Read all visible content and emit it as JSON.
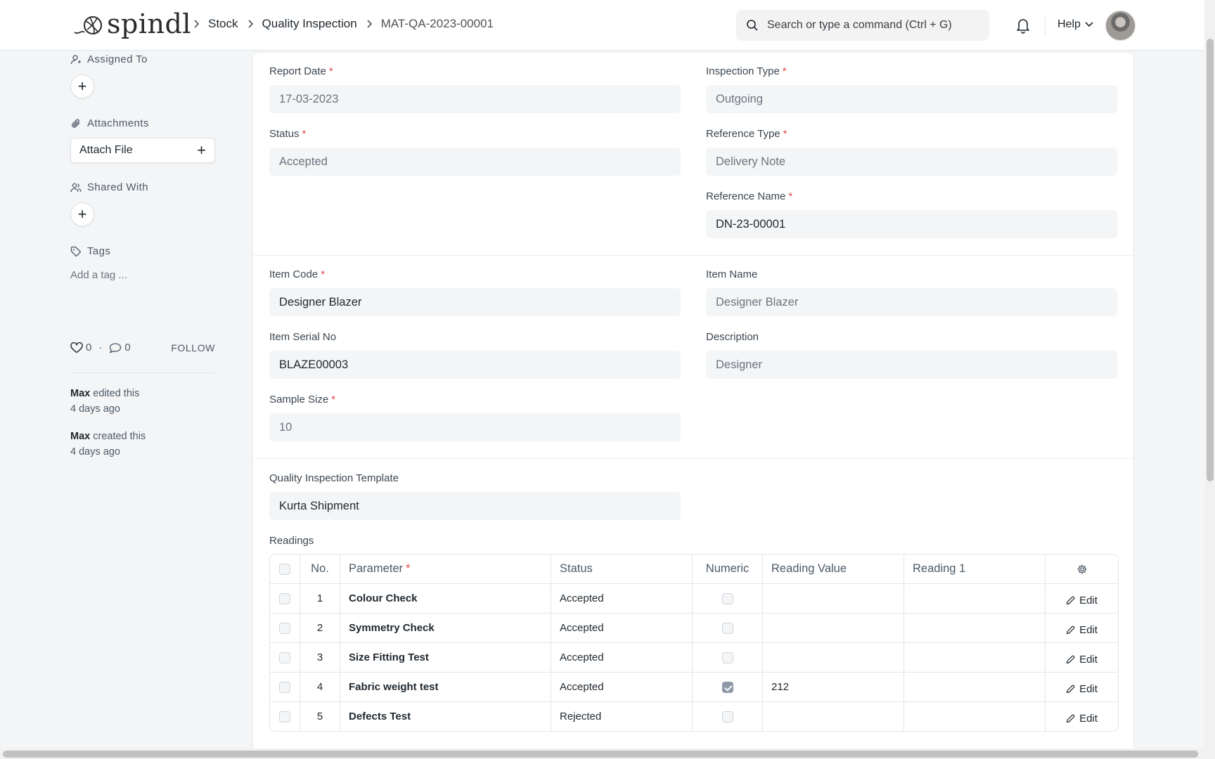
{
  "brand": {
    "name": "spindl"
  },
  "breadcrumb": [
    "Stock",
    "Quality Inspection",
    "MAT-QA-2023-00001"
  ],
  "search": {
    "placeholder": "Search or type a command (Ctrl + G)"
  },
  "nav": {
    "help_label": "Help"
  },
  "sidebar": {
    "assigned_to": "Assigned To",
    "attachments": "Attachments",
    "attach_file": "Attach File",
    "shared_with": "Shared With",
    "tags": "Tags",
    "add_tag": "Add a tag ...",
    "likes": "0",
    "dot": "·",
    "comments": "0",
    "follow": "FOLLOW",
    "activity": [
      {
        "user": "Max",
        "action": "edited this",
        "time": "4 days ago"
      },
      {
        "user": "Max",
        "action": "created this",
        "time": "4 days ago"
      }
    ]
  },
  "form": {
    "report_date": {
      "label": "Report Date",
      "value": "17-03-2023"
    },
    "inspection_type": {
      "label": "Inspection Type",
      "value": "Outgoing"
    },
    "status": {
      "label": "Status",
      "value": "Accepted"
    },
    "reference_type": {
      "label": "Reference Type",
      "value": "Delivery Note"
    },
    "reference_name": {
      "label": "Reference Name",
      "value": "DN-23-00001"
    },
    "item_code": {
      "label": "Item Code",
      "value": "Designer Blazer"
    },
    "item_name": {
      "label": "Item Name",
      "value": "Designer Blazer"
    },
    "item_serial_no": {
      "label": "Item Serial No",
      "value": "BLAZE00003"
    },
    "description": {
      "label": "Description",
      "value": "Designer"
    },
    "sample_size": {
      "label": "Sample Size",
      "value": "10"
    },
    "qi_template": {
      "label": "Quality Inspection Template",
      "value": "Kurta Shipment"
    },
    "required_mark": "*"
  },
  "readings": {
    "label": "Readings",
    "columns": {
      "no": "No.",
      "parameter": "Parameter",
      "status": "Status",
      "numeric": "Numeric",
      "reading_value": "Reading Value",
      "reading_1": "Reading 1"
    },
    "edit_label": "Edit",
    "rows": [
      {
        "no": "1",
        "parameter": "Colour Check",
        "status": "Accepted",
        "numeric": false,
        "reading_value": "",
        "reading_1": ""
      },
      {
        "no": "2",
        "parameter": "Symmetry Check",
        "status": "Accepted",
        "numeric": false,
        "reading_value": "",
        "reading_1": ""
      },
      {
        "no": "3",
        "parameter": "Size Fitting Test",
        "status": "Accepted",
        "numeric": false,
        "reading_value": "",
        "reading_1": ""
      },
      {
        "no": "4",
        "parameter": "Fabric weight test",
        "status": "Accepted",
        "numeric": true,
        "reading_value": "212",
        "reading_1": ""
      },
      {
        "no": "5",
        "parameter": "Defects Test",
        "status": "Rejected",
        "numeric": false,
        "reading_value": "",
        "reading_1": ""
      }
    ]
  }
}
